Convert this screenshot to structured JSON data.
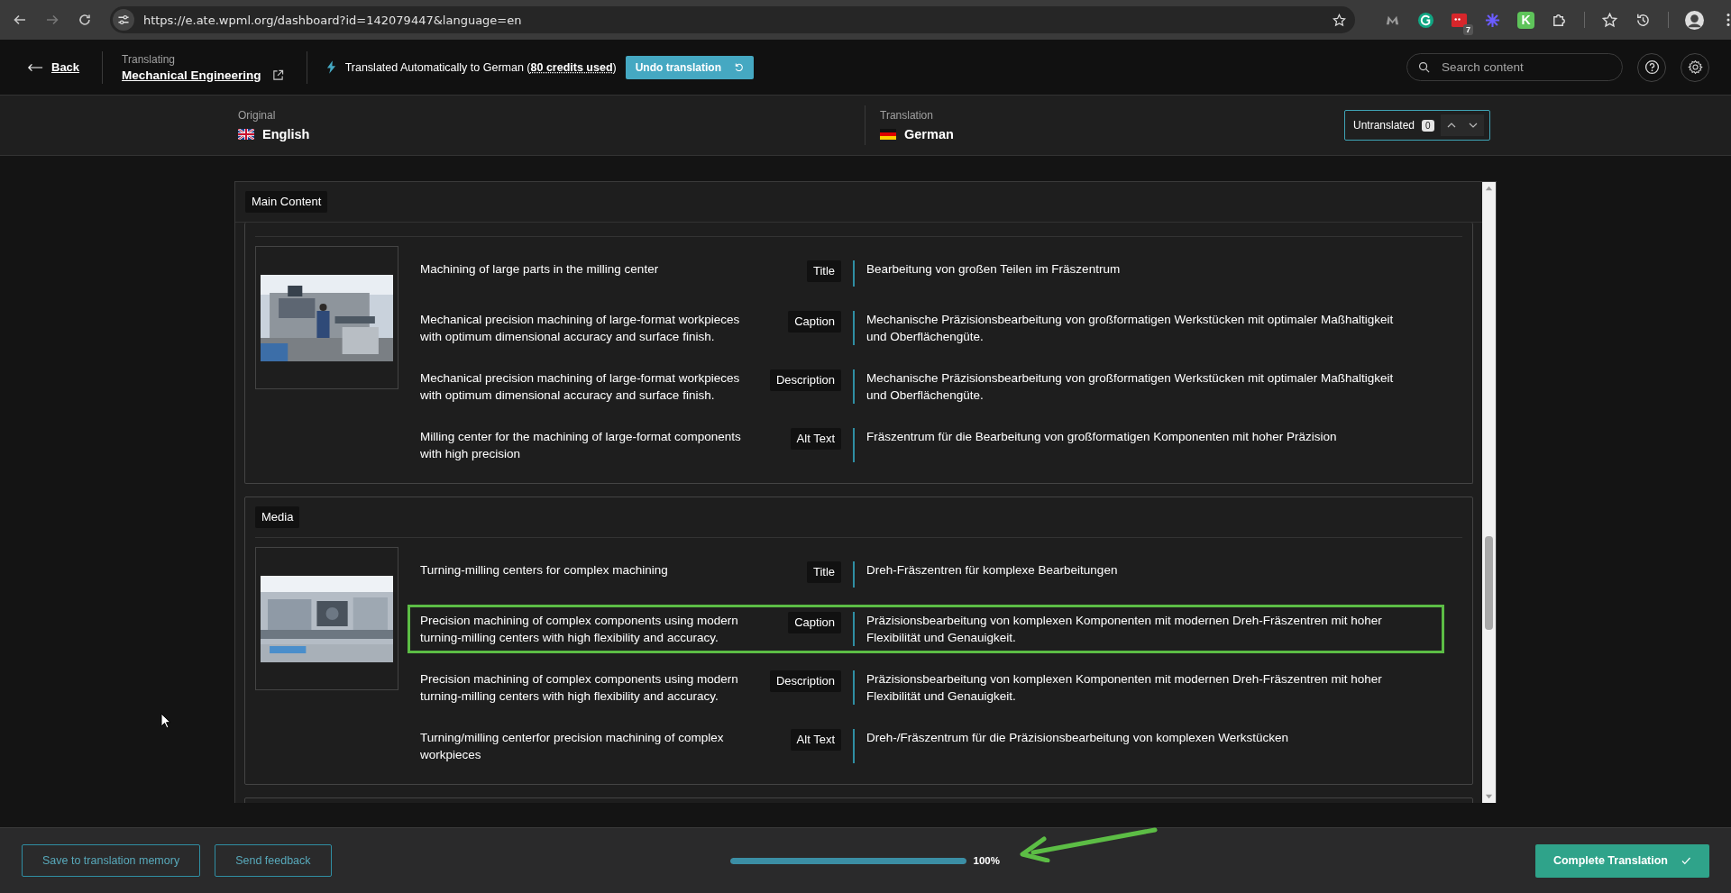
{
  "browser": {
    "url": "https://e.ate.wpml.org/dashboard?id=142079447&language=en",
    "extension_letter": "K",
    "extension_badge": "7"
  },
  "header": {
    "back": "Back",
    "context_label": "Translating",
    "project": "Mechanical Engineering",
    "status": "Translated Automatically to German (**80 credits used**)",
    "undo_button": "Undo translation",
    "search": {
      "placeholder": "Search content"
    }
  },
  "languages": {
    "original": {
      "label": "Original",
      "name": "English"
    },
    "translation": {
      "label": "Translation",
      "name": "German"
    },
    "untranslated": {
      "label": "Untranslated",
      "count": "0"
    }
  },
  "main_section": {
    "title": "Main Content",
    "cards": [
      {
        "rows": [
          {
            "source": "Machining of large parts in the milling center",
            "label": "Title",
            "target": "Bearbeitung von großen Teilen im Fräszentrum",
            "highlighted": false
          },
          {
            "source": "Mechanical precision machining of large-format workpieces with optimum dimensional accuracy and surface finish.",
            "label": "Caption",
            "target": "Mechanische Präzisionsbearbeitung von großformatigen Werkstücken mit optimaler Maßhaltigkeit und Oberflächengüte.",
            "highlighted": false
          },
          {
            "source": "Mechanical precision machining of large-format workpieces with optimum dimensional accuracy and surface finish.",
            "label": "Description",
            "target": "Mechanische Präzisionsbearbeitung von großformatigen Werkstücken mit optimaler Maßhaltigkeit und Oberflächengüte.",
            "highlighted": false
          },
          {
            "source": "Milling center for the machining of large-format components with high precision",
            "label": "Alt Text",
            "target": "Fräszentrum für die Bearbeitung von großformatigen Komponenten mit hoher Präzision",
            "highlighted": false
          }
        ]
      },
      {
        "title": "Media",
        "rows": [
          {
            "source": "Turning-milling centers for complex machining",
            "label": "Title",
            "target": "Dreh-Fräszentren für komplexe Bearbeitungen",
            "highlighted": false
          },
          {
            "source": "Precision machining of complex components using modern turning-milling centers with high flexibility and accuracy.",
            "label": "Caption",
            "target": "Präzisionsbearbeitung von komplexen Komponenten mit modernen Dreh-Fräszentren mit hoher Flexibilität und Genauigkeit.",
            "highlighted": true
          },
          {
            "source": "Precision machining of complex components using modern turning-milling centers with high flexibility and accuracy.",
            "label": "Description",
            "target": "Präzisionsbearbeitung von komplexen Komponenten mit modernen Dreh-Fräszentren mit hoher Flexibilität und Genauigkeit.",
            "highlighted": false
          },
          {
            "source": "Turning/milling centerfor precision machining of complex workpieces",
            "label": "Alt Text",
            "target": "Dreh-/Fräszentrum für die Präzisionsbearbeitung von komplexen Werkstücken",
            "highlighted": false
          }
        ]
      }
    ]
  },
  "footer": {
    "buttons": [
      "Save to translation memory",
      "Send feedback"
    ],
    "progress": {
      "level": 1,
      "reading": "100%"
    },
    "complete_button": "Complete Translation"
  }
}
